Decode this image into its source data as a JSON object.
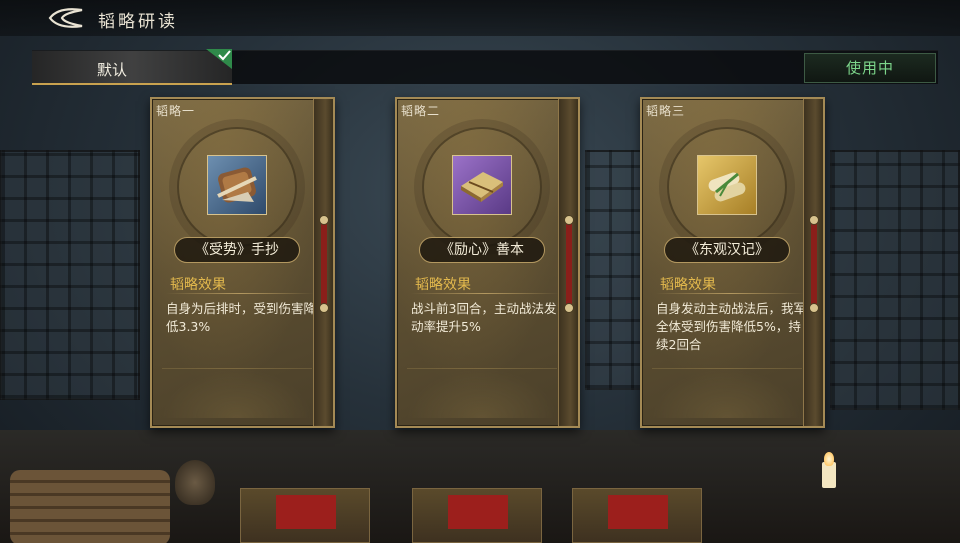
{
  "header": {
    "title": "韬略研读",
    "back_icon": "back-arrow-icon"
  },
  "plan_bar": {
    "tab_label": "默认",
    "tab_selected": true,
    "in_use_label": "使用中",
    "accent_color": "#c9a24f",
    "in_use_color": "#7dd68b"
  },
  "cards": [
    {
      "tag": "韬略一",
      "item_icon": "scroll-bundle-icon",
      "name": "《受势》手抄",
      "effect_title": "韬略效果",
      "effect_desc": "自身为后排时，受到伤害降低3.3%"
    },
    {
      "tag": "韬略二",
      "item_icon": "book-icon",
      "name": "《励心》善本",
      "effect_title": "韬略效果",
      "effect_desc": "战斗前3回合，主动战法发动率提升5%"
    },
    {
      "tag": "韬略三",
      "item_icon": "bamboo-scrolls-icon",
      "name": "《东观汉记》",
      "effect_title": "韬略效果",
      "effect_desc": "自身发动主动战法后，我军全体受到伤害降低5%，持续2回合"
    }
  ]
}
